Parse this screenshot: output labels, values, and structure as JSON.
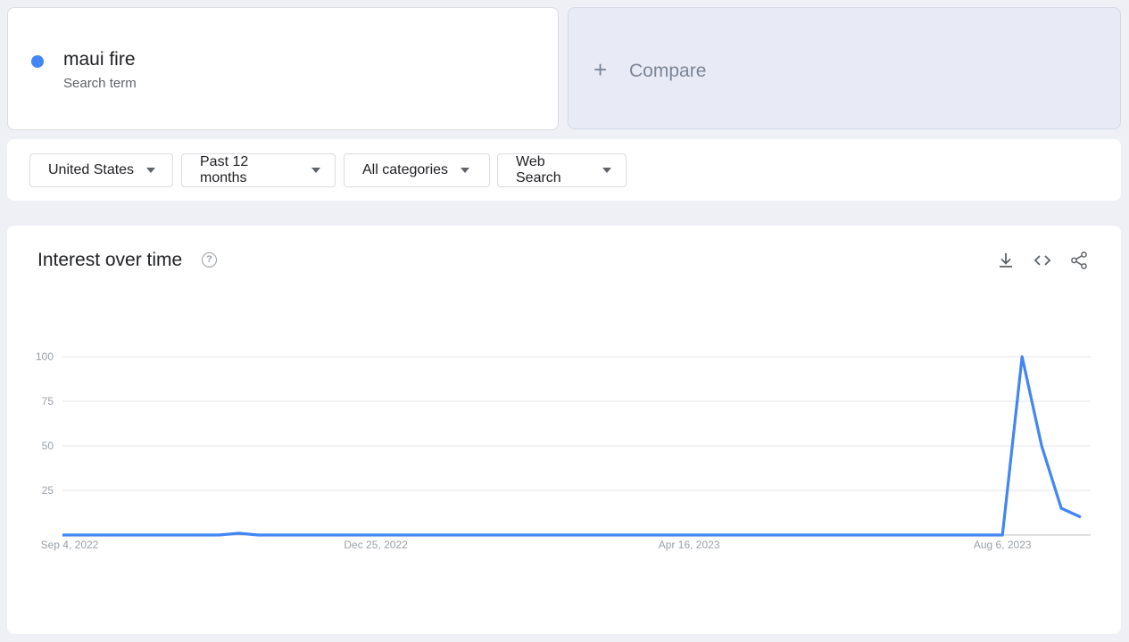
{
  "search_term": {
    "name": "maui fire",
    "type_label": "Search term",
    "color": "#4285f4"
  },
  "compare": {
    "plus": "+",
    "label": "Compare"
  },
  "filters": {
    "region": "United States",
    "time_range": "Past 12 months",
    "category": "All categories",
    "search_type": "Web Search"
  },
  "chart_header": {
    "title": "Interest over time",
    "help_icon": "?",
    "icons": [
      "download-icon",
      "embed-code-icon",
      "share-icon"
    ]
  },
  "chart_data": {
    "type": "line",
    "y_ticks": [
      "100",
      "75",
      "50",
      "25"
    ],
    "ylim": [
      0,
      100
    ],
    "x_tick_labels": [
      "Sep 4, 2022",
      "Dec 25, 2022",
      "Apr 16, 2023",
      "Aug 6, 2023"
    ],
    "x_tick_indices": [
      0,
      16,
      32,
      48
    ],
    "grid": true,
    "series": [
      {
        "color": "#4285f4",
        "values": [
          0,
          0,
          0,
          0,
          0,
          0,
          0,
          0,
          0,
          1,
          0,
          0,
          0,
          0,
          0,
          0,
          0,
          0,
          0,
          0,
          0,
          0,
          0,
          0,
          0,
          0,
          0,
          0,
          0,
          0,
          0,
          0,
          0,
          0,
          0,
          0,
          0,
          0,
          0,
          0,
          0,
          0,
          0,
          0,
          0,
          0,
          0,
          0,
          0,
          100,
          50,
          15,
          10
        ]
      }
    ]
  }
}
